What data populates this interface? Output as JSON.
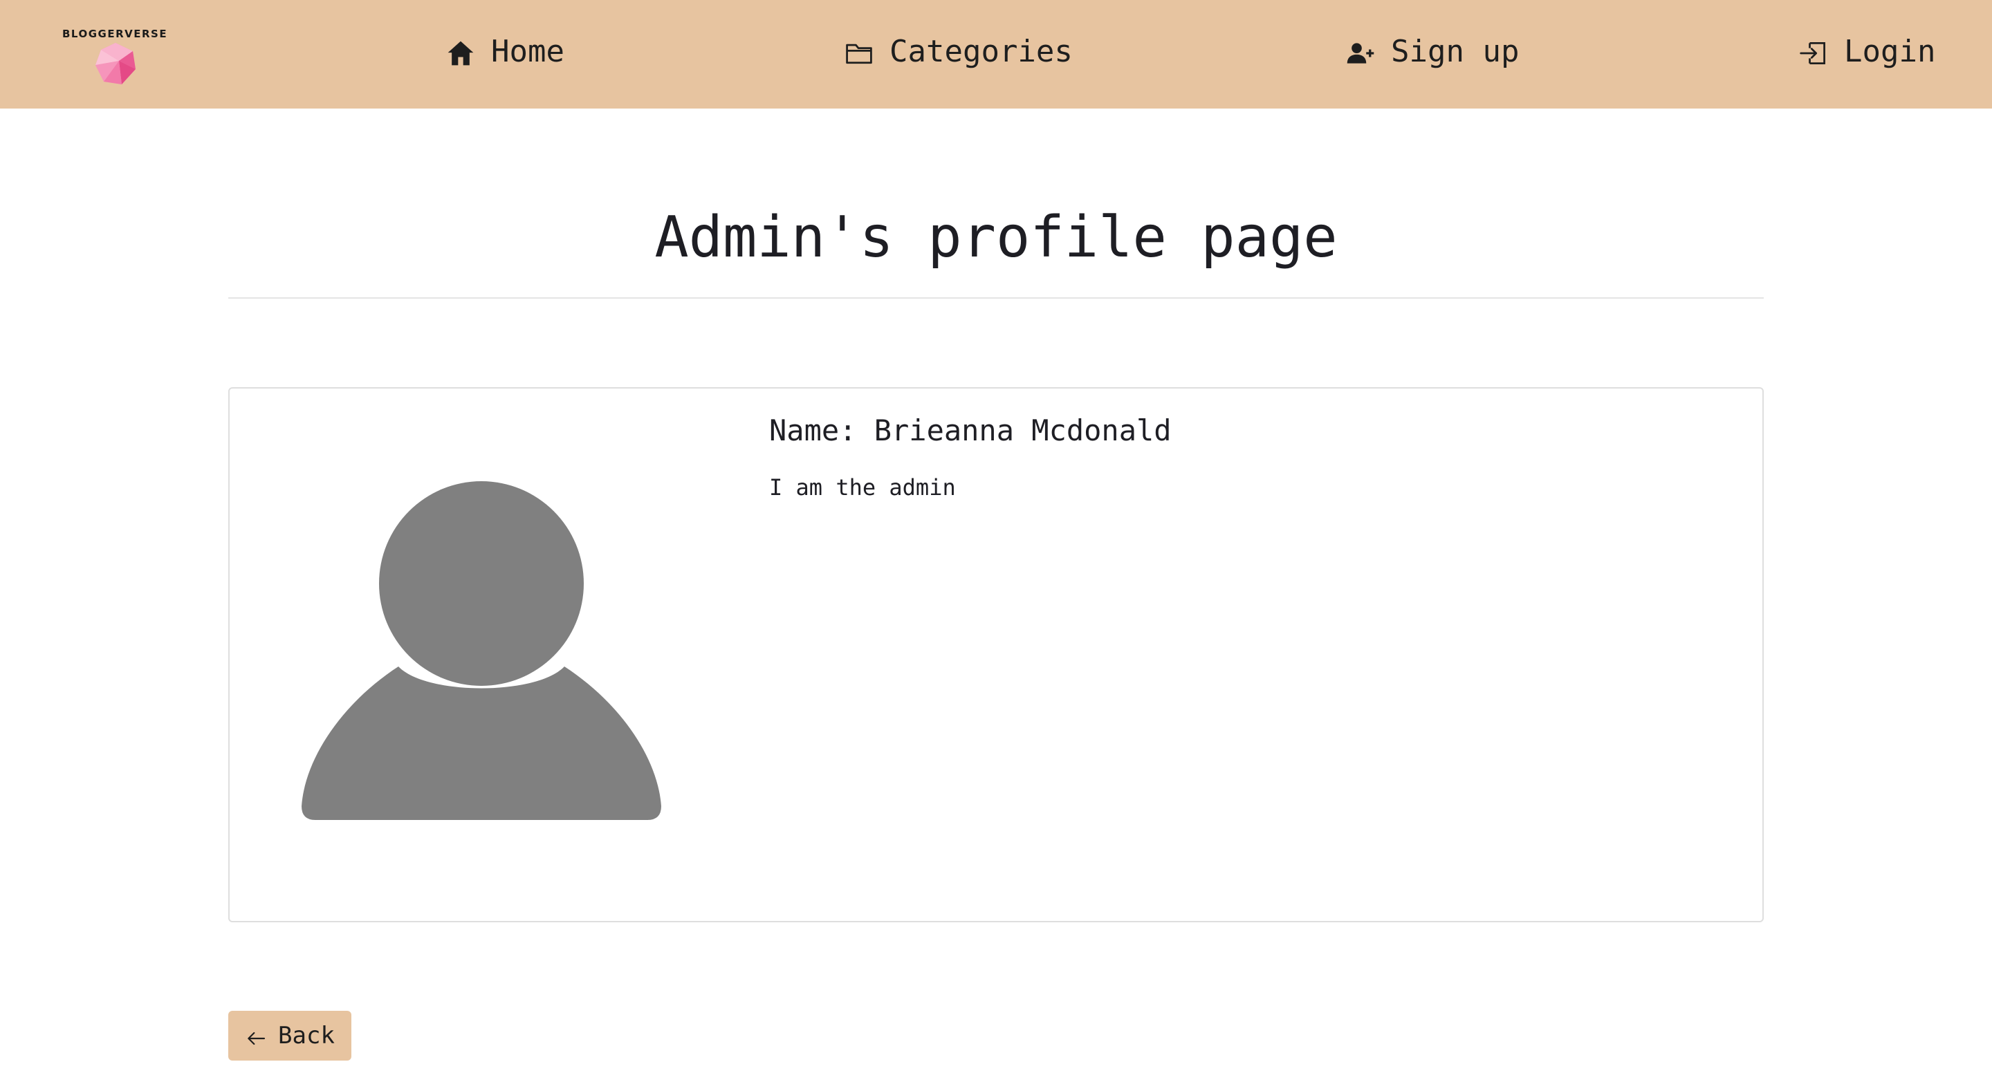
{
  "navbar": {
    "brand": {
      "name": "BLOGGERVERSE",
      "logo_icon": "pink-gem-icon"
    },
    "links": [
      {
        "label": "Home",
        "icon": "home-icon"
      },
      {
        "label": "Categories",
        "icon": "folder-icon"
      },
      {
        "label": "Sign up",
        "icon": "person-plus-icon"
      },
      {
        "label": "Login",
        "icon": "login-icon"
      }
    ]
  },
  "page": {
    "title": "Admin's profile page"
  },
  "profile": {
    "name": "Name: Brieanna Mcdonald",
    "bio": "I am the admin",
    "avatar_icon": "default-user-avatar-icon"
  },
  "actions": {
    "back_label": "Back",
    "back_icon": "arrow-left-icon"
  },
  "colors": {
    "navbar_bg": "#e7c4a0",
    "avatar_gray": "#808080",
    "logo_pink": "#f06aa0"
  }
}
